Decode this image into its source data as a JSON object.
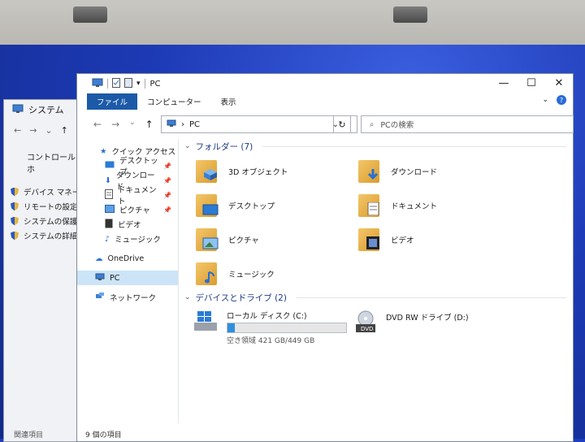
{
  "background_window": {
    "title": "システム",
    "control_panel": "コントロール パネル ホ",
    "items": [
      "デバイス マネージャー",
      "リモートの設定",
      "システムの保護",
      "システムの詳細設定"
    ],
    "bottom": "関連項目"
  },
  "explorer": {
    "title": "PC",
    "tabs": [
      "ファイル",
      "コンピューター",
      "表示"
    ],
    "address": {
      "path": "PC"
    },
    "search_placeholder": "PCの検索",
    "nav": {
      "quick_access": "クイック アクセス",
      "quick_items": [
        "デスクトップ",
        "ダウンロード",
        "ドキュメント",
        "ピクチャ",
        "ビデオ",
        "ミュージック"
      ],
      "onedrive": "OneDrive",
      "pc": "PC",
      "network": "ネットワーク"
    },
    "folders_group": "フォルダー (7)",
    "folders": [
      "3D オブジェクト",
      "ダウンロード",
      "デスクトップ",
      "ドキュメント",
      "ピクチャ",
      "ビデオ",
      "ミュージック"
    ],
    "devices_group": "デバイスとドライブ (2)",
    "local_disk": {
      "name": "ローカル ディスク (C:)",
      "free_text": "空き領域 421 GB/449 GB",
      "used_fraction": 0.06
    },
    "dvd_drive": {
      "name": "DVD RW ドライブ (D:)"
    },
    "status": "9 個の項目"
  },
  "colors": {
    "accent": "#1c5aa8",
    "selection": "#cce4f7",
    "desktop": "#1d3ab5"
  }
}
